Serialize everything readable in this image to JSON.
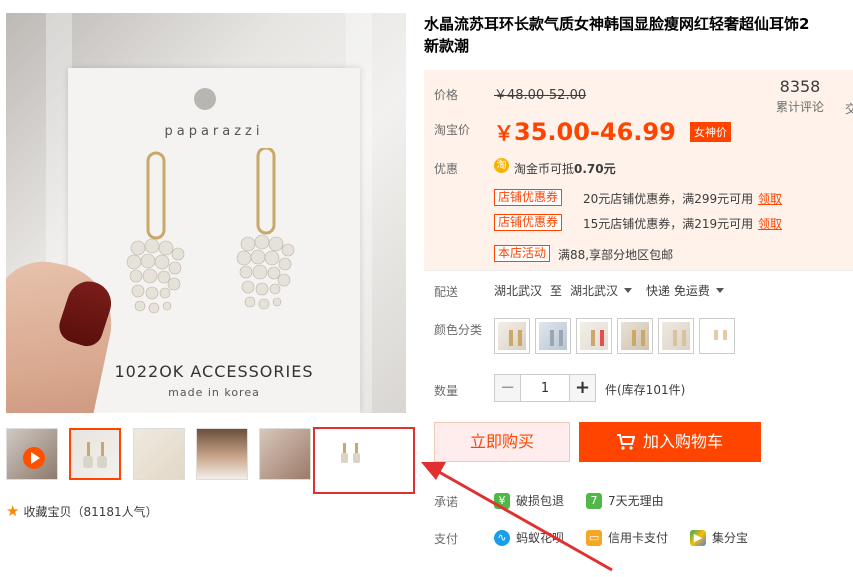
{
  "main_image": {
    "brand": "paparazzi",
    "card_title": "1022OK ACCESSORIES",
    "card_sub": "made in korea"
  },
  "favorite": {
    "label": "收藏宝贝（81181人气）",
    "icon": "star-icon"
  },
  "product": {
    "title_line1": "水晶流苏耳环长款气质女神韩国显脸瘦网红轻奢超仙耳饰2",
    "title_line2": "新款潮"
  },
  "price": {
    "price_label": "价格",
    "original": "￥48.00-52.00",
    "taobao_label": "淘宝价",
    "symbol": "￥",
    "current": "35.00-46.99",
    "badge": "女神价",
    "reviews_count": "8358",
    "reviews_label": "累计评论",
    "cut_label": "交"
  },
  "promo": {
    "label": "优惠",
    "coin_icon": "taobao-coin-icon",
    "coin_text_prefix": "淘金币可抵",
    "coin_amount": "0.70元",
    "coupons": [
      {
        "tag": "店铺优惠券",
        "text": "20元店铺优惠券，满299元可用",
        "action": "领取"
      },
      {
        "tag": "店铺优惠券",
        "text": "15元店铺优惠券，满219元可用",
        "action": "领取"
      }
    ],
    "activity_tag": "本店活动",
    "activity_text": "满88,享部分地区包邮"
  },
  "shipping": {
    "label": "配送",
    "from": "湖北武汉",
    "to_word": "至",
    "to": "湖北武汉",
    "method": "快递 免运费"
  },
  "color": {
    "label": "颜色分类"
  },
  "quantity": {
    "label": "数量",
    "minus": "−",
    "value": "1",
    "plus": "+",
    "stock": "件(库存101件)"
  },
  "actions": {
    "buy_now": "立即购买",
    "add_to_cart": "加入购物车"
  },
  "promise": {
    "label": "承诺",
    "items": [
      "破损包退",
      "7天无理由"
    ]
  },
  "payment": {
    "label": "支付",
    "items": [
      "蚂蚁花呗",
      "信用卡支付",
      "集分宝"
    ]
  },
  "colors": {
    "accent": "#ff4400",
    "price_bg": "#fef2ea",
    "highlight": "#e03030"
  }
}
